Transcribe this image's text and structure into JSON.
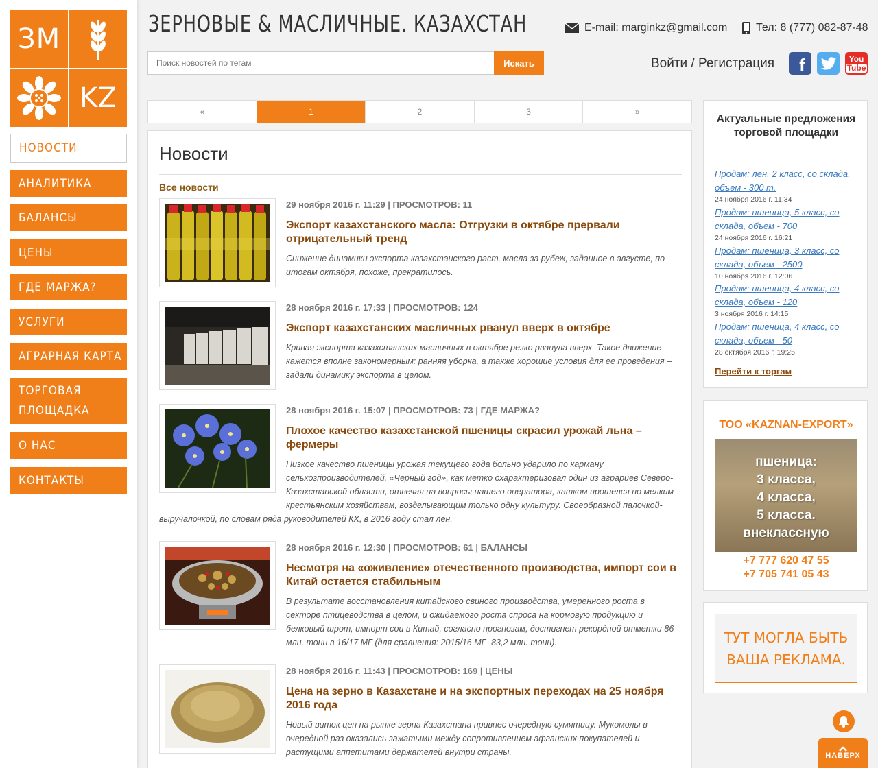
{
  "logo": {
    "cell1": "ЗМ",
    "cell4": "KZ"
  },
  "nav": [
    {
      "label": "Новости",
      "active": true
    },
    {
      "label": "Аналитика"
    },
    {
      "label": "Балансы"
    },
    {
      "label": "Цены"
    },
    {
      "label": "Где маржа?"
    },
    {
      "label": "Услуги"
    },
    {
      "label": "Аграрная карта"
    },
    {
      "label": "Торговая площадка"
    },
    {
      "label": "О нас"
    },
    {
      "label": "Контакты"
    }
  ],
  "header": {
    "title": "ЗЕРНОВЫЕ & МАСЛИЧНЫЕ. КАЗАХСТАН",
    "email": "E-mail: marginkz@gmail.com",
    "phone": "Тел: 8 (777) 082-87-48",
    "search_placeholder": "Поиск новостей по тегам",
    "search_button": "Искать",
    "login": "Войти / Регистрация"
  },
  "social": {
    "youtube_top": "You",
    "youtube_bottom": "Tube"
  },
  "pagination": [
    "«",
    "1",
    "2",
    "3",
    "»"
  ],
  "news": {
    "title": "Новости",
    "all_news": "Все новости",
    "items": [
      {
        "meta": "29 ноября 2016 г. 11:29 | ПРОСМОТРОВ: 11",
        "headline": "Экспорт казахстанского масла: Отгрузки в октябре прервали отрицательный тренд",
        "excerpt": "Снижение динамики экспорта казахстанского раст. масла за рубеж, заданное в августе, по итогам октября, похоже, прекратилось."
      },
      {
        "meta": "28 ноября 2016 г. 17:33 | ПРОСМОТРОВ: 124",
        "headline": "Экспорт казахстанских масличных рванул вверх в октябре",
        "excerpt": "Кривая экспорта казахстанских масличных в октябре резко рванула вверх. Такое движение кажется вполне закономерным: ранняя уборка, а также хорошие условия для ее проведения – задали динамику экспорта в целом."
      },
      {
        "meta": "28 ноября 2016 г. 15:07 | ПРОСМОТРОВ: 73 | ГДЕ МАРЖА?",
        "headline": "Плохое качество казахстанской пшеницы скрасил урожай льна – фермеры",
        "excerpt_a": "Низкое качество пшеницы урожая текущего года больно ударило по карману сельхозпроизводителей. «Черный год», как метко охарактеризовал один из аграриев Северо-Казахстанской области, отвечая на вопросы нашего оператора, катком прошелся по мелким крестьянским хозяйствам, возделывающим только одну культуру. Своеобразной палочкой-",
        "excerpt_b": "выручалочкой, по словам ряда руководителей КХ, в 2016 году стал лен."
      },
      {
        "meta": "28 ноября 2016 г. 12:30 | ПРОСМОТРОВ: 61 | БАЛАНСЫ",
        "headline": "Несмотря на «оживление» отечественного производства, импорт сои в Китай остается  стабильным",
        "excerpt": "В результате восстановления китайского свиного производства, умеренного роста в секторе птицеводства в целом, и ожидаемого роста спроса на кормовую продукцию и белковый шрот, импорт сои в Китай, согласно прогнозам, достигнет рекордной отметки 86 млн. тонн  в 16/17 МГ (для сравнения: 2015/16 МГ- 83,2 млн. тонн)."
      },
      {
        "meta": "28 ноября 2016 г. 11:43 | ПРОСМОТРОВ: 169 | ЦЕНЫ",
        "headline": "Цена на зерно в Казахстане и на экспортных переходах на 25 ноября 2016 года",
        "excerpt": "Новый виток цен на рынке зерна Казахстана привнес очередную сумятицу. Мукомолы в очередной раз оказались зажатыми между сопротивлением афганских покупателей и растущими аппетитами держателей внутри страны."
      }
    ]
  },
  "offers": {
    "title": "Актуальные предложения торговой площадки",
    "items": [
      {
        "text": "Продам: лен, 2 класс, со склада, объем - 300 т.",
        "date": "24 ноября 2016 г. 11:34"
      },
      {
        "text": "Продам: пшеница, 5 класс, со склада, объем - 700",
        "date": "24 ноября 2016 г. 16:21"
      },
      {
        "text": "Продам: пшеница, 3 класс, со склада, объем - 2500",
        "date": "10 ноября 2016 г. 12:06"
      },
      {
        "text": "Продам: пшеница, 4 класс, со склада, объем - 120",
        "date": "3 ноября 2016 г. 14:15"
      },
      {
        "text": "Продам: пшеница, 4 класс, со склада, объем - 50",
        "date": "28 октября 2016 г. 19:25"
      }
    ],
    "go_trade": "Перейти к торгам"
  },
  "ad1": {
    "title": "ТОО «KAZNAN-EXPORT»",
    "lines": [
      "пшеница:",
      "3 класса,",
      "4 класса,",
      "5 класса.",
      "внеклассную"
    ],
    "phone1": "+7 777 620 47 55",
    "phone2": "+7 705 741 05 43"
  },
  "ad2": {
    "line1": "ТУТ МОГЛА БЫТЬ",
    "line2": "ВАША РЕКЛАМА."
  },
  "to_top": "НАВЕРХ",
  "colors": {
    "accent": "#f07f1a",
    "headline": "#8b4a0e",
    "link": "#3a7bc0"
  }
}
